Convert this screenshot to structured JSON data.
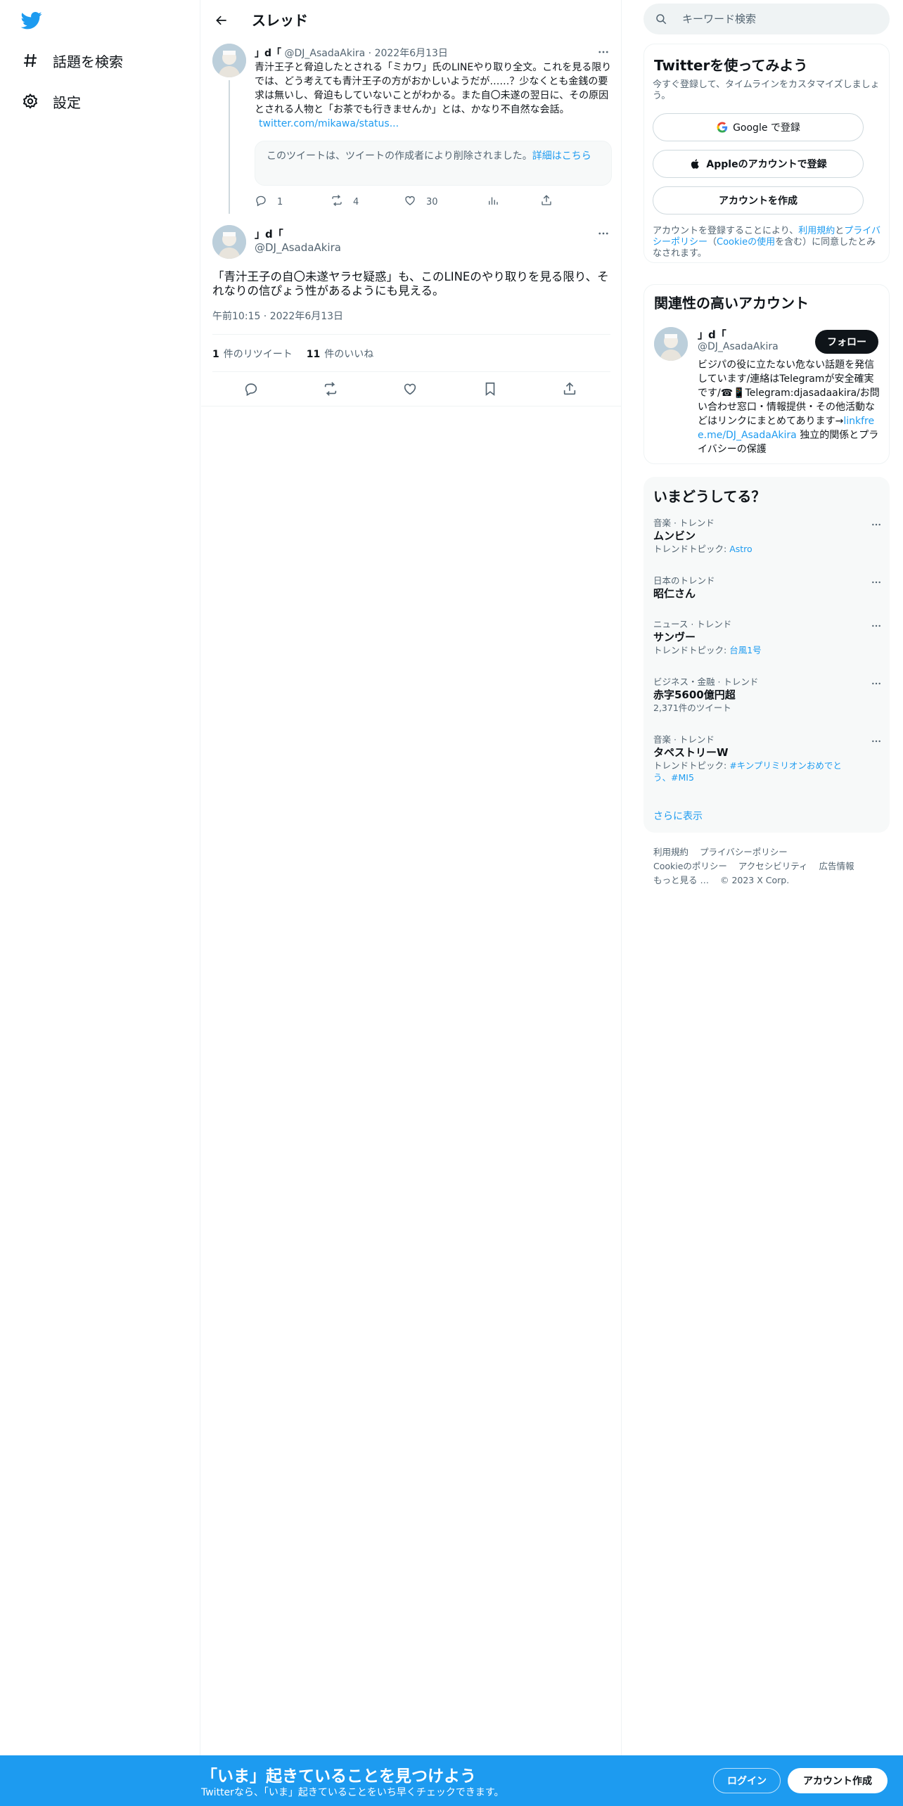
{
  "nav": {
    "items": [
      {
        "label": "話題を検索",
        "icon": "hashtag-icon"
      },
      {
        "label": "設定",
        "icon": "gear-icon"
      }
    ]
  },
  "header": {
    "title": "スレッド"
  },
  "tweet1": {
    "name": "」d「",
    "handle_date": "@DJ_AsadaAkira · 2022年6月13日",
    "body": "青汁王子と脅迫したとされる「ミカワ」氏のLINEやり取り全文。これを見る限りでは、どう考えても青汁王子の方がおかしいようだが……？少なくとも金銭の要求は無いし、脅迫もしていないことがわかる。また自〇未遂の翌日に、その原因とされる人物と「お茶でも行きませんか」とは、かなり不自然な会話。",
    "link": "twitter.com/mikawa/status...",
    "deleted_text": "このツイートは、ツイートの作成者により削除されました。",
    "deleted_link": "詳細はこちら",
    "reply_count": "1",
    "retweet_count": "4",
    "like_count": "30"
  },
  "tweet2": {
    "name": "」d「",
    "handle": "@DJ_AsadaAkira",
    "body": "「青汁王子の自〇未遂ヤラセ疑惑」も、このLINEのやり取りを見る限り、それなりの信ぴょう性があるようにも見える。",
    "time": "午前10:15 · 2022年6月13日",
    "retweets_num": "1",
    "retweets_label": "件のリツイート",
    "likes_num": "11",
    "likes_label": "件のいいね"
  },
  "search": {
    "placeholder": "キーワード検索"
  },
  "signup": {
    "title": "Twitterを使ってみよう",
    "subtitle": "今すぐ登録して、タイムラインをカスタマイズしましょう。",
    "google_label": "Google で登録",
    "apple_label": "Appleのアカウントで登録",
    "create_label": "アカウントを作成",
    "legal_prefix": "アカウントを登録することにより、",
    "legal_terms": "利用規約",
    "legal_and": "と",
    "legal_privacy": "プライバシーポリシー",
    "legal_paren_open": "（",
    "legal_cookie": "Cookieの使用",
    "legal_suffix": "を含む）に同意したとみなされます。"
  },
  "related": {
    "title": "関連性の高いアカウント",
    "name": "」d「",
    "handle": "@DJ_AsadaAkira",
    "follow_label": "フォロー",
    "bio": "ビジパの役に立たない危ない話題を発信しています/連絡はTelegramが安全確実です/☎📱Telegram:djasadaakira/お問い合わせ窓口・情報提供・その他活動などはリンクにまとめてあります→",
    "bio_link": "linkfree.me/DJ_AsadaAkira",
    "bio_tail": " 独立的関係とプライバシーの保護"
  },
  "trends": {
    "title": "いまどうしてる？",
    "items": [
      {
        "meta": "音楽 · トレンド",
        "name": "ムンビン",
        "sub_prefix": "トレンドトピック: ",
        "sub_link": "Astro"
      },
      {
        "meta": "日本のトレンド",
        "name": "昭仁さん",
        "sub_prefix": "",
        "sub_link": ""
      },
      {
        "meta": "ニュース · トレンド",
        "name": "サンヴー",
        "sub_prefix": "トレンドトピック: ",
        "sub_link": "台風1号"
      },
      {
        "meta": "ビジネス・金融 · トレンド",
        "name": "赤字5600億円超",
        "sub_prefix": "2,371件のツイート",
        "sub_link": ""
      },
      {
        "meta": "音楽 · トレンド",
        "name": "タペストリーW",
        "sub_prefix": "トレンドトピック: ",
        "sub_link": "#キンプリミリオンおめでとう、#MI5"
      }
    ],
    "show_more": "さらに表示"
  },
  "footer": {
    "links": [
      "利用規約",
      "プライバシーポリシー",
      "Cookieのポリシー",
      "アクセシビリティ",
      "広告情報",
      "もっと見る …",
      "© 2023 X Corp."
    ]
  },
  "bottombar": {
    "title": "「いま」起きていることを見つけよう",
    "subtitle": "Twitterなら、「いま」起きていることをいち早くチェックできます。",
    "login_label": "ログイン",
    "create_label": "アカウント作成"
  },
  "colors": {
    "accent": "#1d9bf0",
    "text": "#0f1419",
    "muted": "#536471"
  }
}
